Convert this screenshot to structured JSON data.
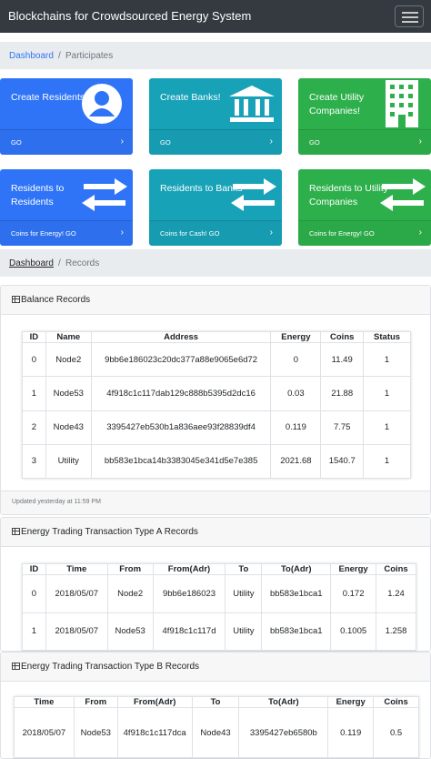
{
  "navbar": {
    "brand": "Blockchains for Crowdsourced Energy System"
  },
  "breadcrumb_top": {
    "home": "Dashboard",
    "separator": "/",
    "current": "Participates"
  },
  "cards": [
    {
      "title": "Create Residents",
      "footer": "GO",
      "chevron": "›",
      "icon": "user-icon",
      "color": "#2f74f6"
    },
    {
      "title": "Create Banks!",
      "footer": "GO",
      "chevron": "›",
      "icon": "bank-icon",
      "color": "#17a2b8"
    },
    {
      "title": "Create Utility Companies!",
      "footer": "GO",
      "chevron": "›",
      "icon": "building-icon",
      "color": "#2db04b"
    },
    {
      "title": "Residents to Residents",
      "footer": "Coins for Energy! GO",
      "chevron": "›",
      "icon": "exchange-icon",
      "color": "#2f74f6"
    },
    {
      "title": "Residents to Banks",
      "footer": "Coins for Cash! GO",
      "chevron": "›",
      "icon": "exchange-icon",
      "color": "#17a2b8"
    },
    {
      "title": "Residents to Utility Companies",
      "footer": "Coins for Energy! GO",
      "chevron": "›",
      "icon": "exchange-icon",
      "color": "#2db04b"
    }
  ],
  "breadcrumb_records": {
    "home": "Dashboard",
    "separator": "/",
    "current": "Records"
  },
  "balance": {
    "title": "Balance Records",
    "headers": [
      "ID",
      "Name",
      "Address",
      "Energy",
      "Coins",
      "Status"
    ],
    "rows": [
      [
        "0",
        "Node2",
        "9bb6e186023c20dc377a88e9065e6d72",
        "0",
        "11.49",
        "1"
      ],
      [
        "1",
        "Node53",
        "4f918c1c117dab129c888b5395d2dc16",
        "0.03",
        "21.88",
        "1"
      ],
      [
        "2",
        "Node43",
        "3395427eb530b1a836aee93f28839df4",
        "0.119",
        "7.75",
        "1"
      ],
      [
        "3",
        "Utility",
        "bb583e1bca14b3383045e341d5e7e385",
        "2021.68",
        "1540.7",
        "1"
      ]
    ],
    "footer": "Updated yesterday at 11:59 PM"
  },
  "type_a": {
    "title": "Energy Trading Transaction Type A Records",
    "headers": [
      "ID",
      "Time",
      "From",
      "From(Adr)",
      "To",
      "To(Adr)",
      "Energy",
      "Coins"
    ],
    "rows": [
      [
        "0",
        "2018/05/07",
        "Node2",
        "9bb6e186023",
        "Utility",
        "bb583e1bca1",
        "0.172",
        "1.24"
      ],
      [
        "1",
        "2018/05/07",
        "Node53",
        "4f918c1c117d",
        "Utility",
        "bb583e1bca1",
        "0.1005",
        "1.258"
      ]
    ]
  },
  "type_b": {
    "title": "Energy Trading Transaction Type B Records",
    "headers": [
      "Time",
      "From",
      "From(Adr)",
      "To",
      "To(Adr)",
      "Energy",
      "Coins"
    ],
    "rows": [
      [
        "2018/05/07",
        "Node53",
        "4f918c1c117dca",
        "Node43",
        "3395427eb6580b",
        "0.119",
        "0.5"
      ]
    ]
  }
}
